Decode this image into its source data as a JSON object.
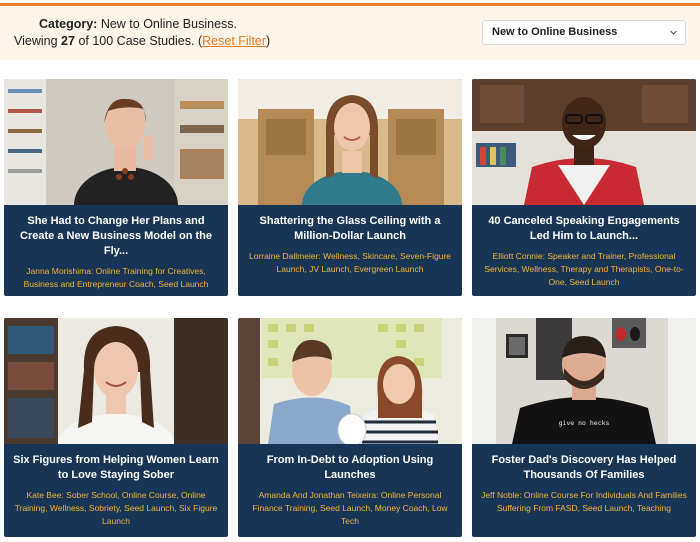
{
  "filter": {
    "category_label": "Category:",
    "category_value": "New to Online Business.",
    "viewing_prefix": "Viewing",
    "viewing_count": "27",
    "viewing_suffix": "of 100 Case Studies.",
    "reset_open": "(",
    "reset_label": "Reset Filter",
    "reset_close": ")",
    "select_value": "New to Online Business"
  },
  "colors": {
    "accent": "#ee7b2e",
    "card_bg": "#183555",
    "tag_text": "#f3b43b",
    "panel_bg": "#fdf4ea"
  },
  "cards": [
    {
      "title": "She Had to Change Her Plans and Create a New Business Model on the Fly...",
      "tags": "Janna Morishima: Online Training for Creatives, Business and Entrepreneur Coach, Seed Launch"
    },
    {
      "title": "Shattering the Glass Ceiling with a Million-Dollar Launch",
      "tags": "Lorraine Dallmeier: Wellness, Skincare, Seven-Figure Launch, JV Launch, Evergreen Launch"
    },
    {
      "title": "40 Canceled Speaking Engagements Led Him to Launch...",
      "tags": "Elliott Connie: Speaker and Trainer, Professional Services, Wellness, Therapy and Therapists, One-to-One, Seed Launch"
    },
    {
      "title": "Six Figures from Helping Women Learn to Love Staying Sober",
      "tags": "Kate Bee: Sober School, Online Course, Online Training, Wellness, Sobriety, Seed Launch, Six Figure Launch"
    },
    {
      "title": "From In-Debt to Adoption Using Launches",
      "tags": "Amanda And Jonathan Teixeira: Online Personal Finance Training, Seed Launch, Money Coach, Low Tech"
    },
    {
      "title": "Foster Dad's Discovery Has Helped Thousands Of Families",
      "tags": "Jeff Noble: Online Course For Individuals And Families Suffering From FASD, Seed Launch, Teaching"
    }
  ],
  "shirt_text": "give no hecks"
}
